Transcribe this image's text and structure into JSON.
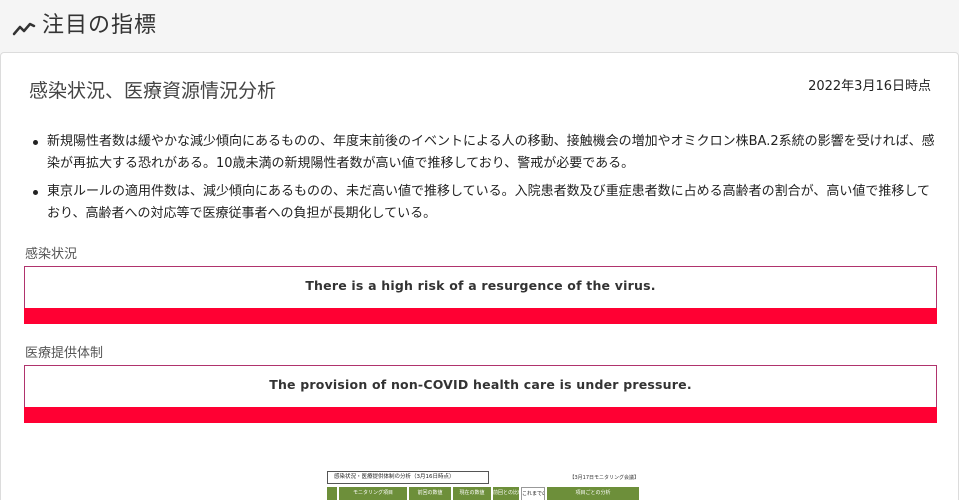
{
  "header": {
    "title": "注目の指標",
    "icon": "trend-line-icon"
  },
  "analysis": {
    "title": "感染状況、医療資源情況分析",
    "date": "2022年3月16日時点",
    "bullets": [
      "新規陽性者数は緩やかな減少傾向にあるものの、年度末前後のイベントによる人の移動、接触機会の増加やオミクロン株BA.2系統の影響を受ければ、感染が再拡大する恐れがある。10歳未満の新規陽性者数が高い値で推移しており、警戒が必要である。",
      "東京ルールの適用件数は、減少傾向にあるものの、未だ高い値で推移している。入院患者数及び重症患者数に占める高齢者の割合が、高い値で推移しており、高齢者への対応等で医療従事者への負担が長期化している。"
    ]
  },
  "infection": {
    "label": "感染状況",
    "message": "There is a high risk of a resurgence of the virus.",
    "bar_color": "#ff0033",
    "border_color": "#b0336d"
  },
  "medical": {
    "label": "医療提供体制",
    "message": "The provision of non-COVID health care is under pressure.",
    "bar_color": "#ff0033",
    "border_color": "#b0336d"
  },
  "thumbnail": {
    "title": "感染状況・医療提供体制の分析（3月16日時点）",
    "date": "【3月17日モニタリング会議】",
    "cells": [
      "モニタリング項目",
      "前回の数値",
      "現在の数値",
      "前回との比較",
      "これまでの最大値",
      "項目ごとの分析"
    ]
  }
}
